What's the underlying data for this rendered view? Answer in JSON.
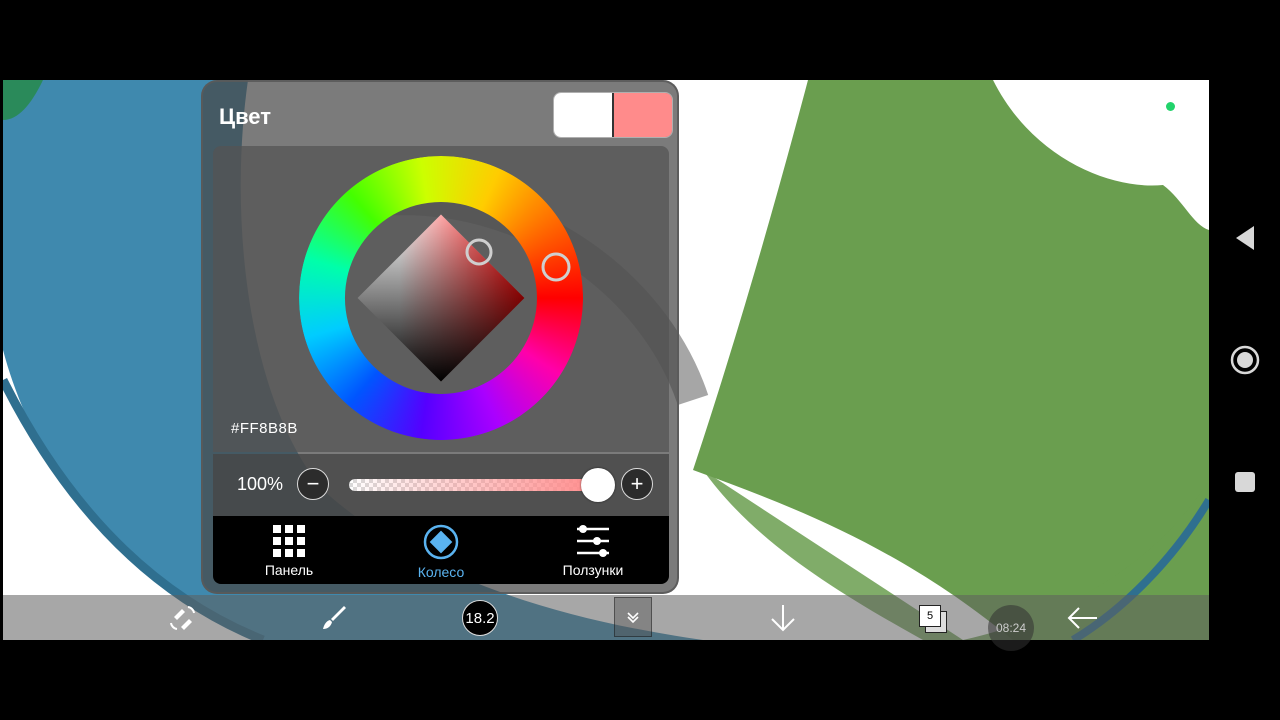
{
  "panel": {
    "title": "Цвет",
    "primary_swatch": "#FFFFFF",
    "secondary_swatch": "#FF8B8B",
    "hex_value": "#FF8B8B",
    "opacity_label": "100%",
    "opacity_value": 1.0,
    "minus_symbol": "−",
    "plus_symbol": "+",
    "tabs": [
      {
        "label": "Панель",
        "icon": "grid-icon",
        "active": false
      },
      {
        "label": "Колесо",
        "icon": "diamond-wheel-icon",
        "active": true
      },
      {
        "label": "Ползунки",
        "icon": "sliders-icon",
        "active": false
      }
    ]
  },
  "toolbar": {
    "brush_size": "18.2",
    "layer_count": "5",
    "clock": "08:24",
    "icons": [
      "swap-tool-icon",
      "brush-icon",
      "brush-size-indicator",
      "expand-chevron-icon",
      "download-arrow-icon",
      "layers-icon",
      "back-arrow-icon"
    ]
  },
  "android_nav": {
    "icons": [
      "back-triangle-icon",
      "home-circle-icon",
      "recents-square-icon"
    ]
  },
  "colors": {
    "accent": "#5AB3F0",
    "canvas_green": "#6A9E4F",
    "canvas_blue": "#3F89AE",
    "status_dot": "#22D36B"
  }
}
